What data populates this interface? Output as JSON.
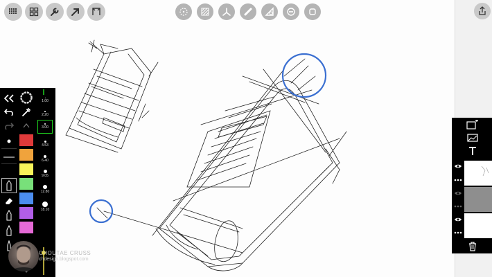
{
  "toolbar_left": {
    "icons": [
      "grid-menu-icon",
      "gallery-icon",
      "wrench-icon",
      "arrow-icon",
      "fullscreen-icon"
    ]
  },
  "toolbar_center": {
    "icons": [
      "symmetry-icon",
      "hatch-icon",
      "perspective-icon",
      "ruler-icon",
      "ellipse-guide-icon",
      "minus-circle-icon",
      "stop-icon"
    ]
  },
  "toolbar_right": {
    "icons": [
      "share-icon"
    ]
  },
  "brush_palette": {
    "colors": [
      "#e03a3a",
      "#f0a33c",
      "#f7f35a",
      "#78e07a",
      "#4b8df0",
      "#b15ee8",
      "#e56ad6"
    ],
    "sizes": [
      "1.00",
      "2.20",
      "3.00",
      "4.53",
      "6.40",
      "9.05",
      "12.80",
      "18.10"
    ],
    "selected_size": "3.00",
    "accent": "#1fd11f"
  },
  "layers_panel": {
    "layer_count": 3
  },
  "watermark": {
    "name": "CHOUTAE CRUSS",
    "url": "chdesign.blogspot.com"
  },
  "colors": {
    "guide_circle": "#3a6fd1",
    "canvas": "#fdfdfd"
  }
}
